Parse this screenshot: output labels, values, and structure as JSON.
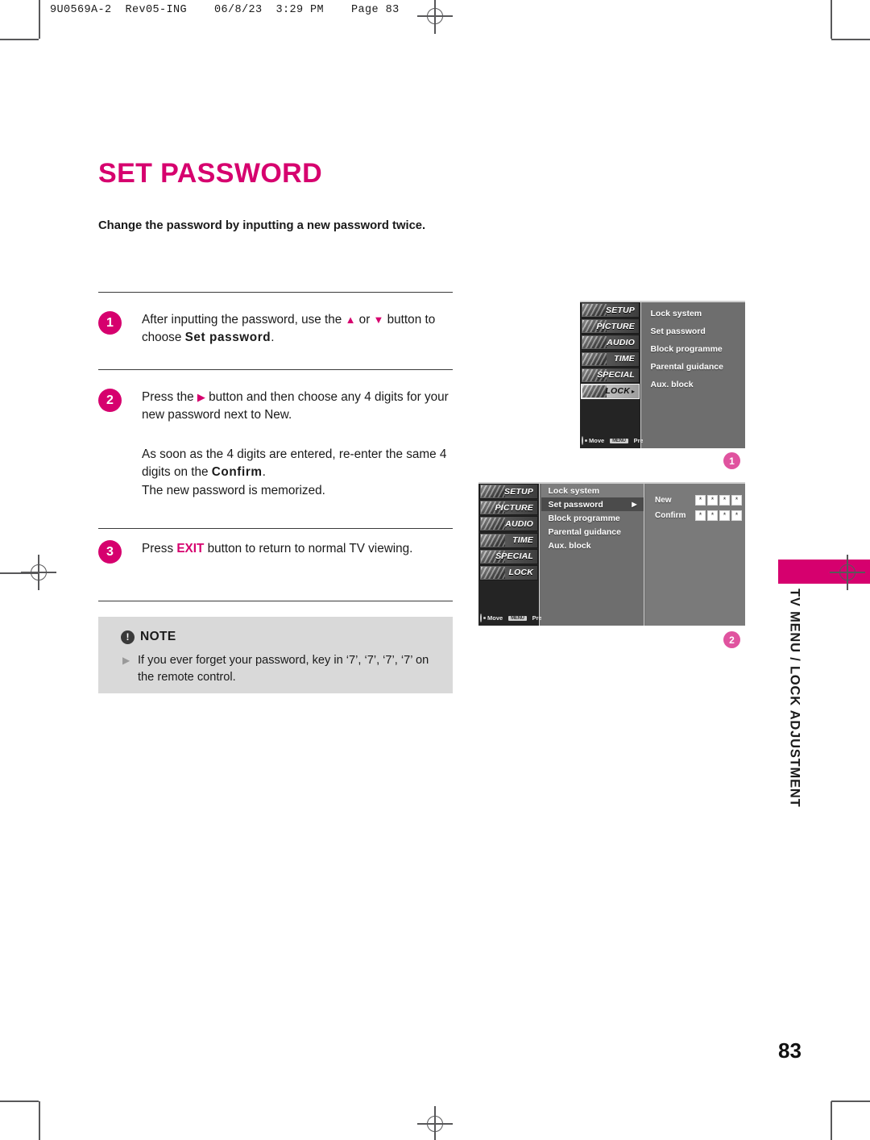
{
  "document": {
    "running_header": "9U0569A-2  Rev05-ING    06/8/23  3:29 PM    Page 83",
    "page_number": "83",
    "side_tab_label": "TV MENU / LOCK ADJUSTMENT",
    "accent_color": "#d6006e",
    "note_bg_color": "#d9d9d9"
  },
  "title": "SET PASSWORD",
  "subtitle": "Change the password by inputting a new password twice.",
  "steps": [
    {
      "number": "1",
      "text_before": "After inputting the password, use the ",
      "tri_up": "▲",
      "text_mid": " or ",
      "tri_down": "▼",
      "text_after": " button to choose ",
      "bold_term": "Set password",
      "text_end": "."
    },
    {
      "number": "2",
      "text_before": "Press the ",
      "tri_right": "▶",
      "text_after": " button and then choose any 4 digits for your new password next to New."
    },
    {
      "number": "",
      "text_before": "As soon as the 4 digits are entered, re-enter the same 4 digits on the ",
      "bold_term": "Confirm",
      "text_after": ".",
      "line2": "The new password is memorized."
    },
    {
      "number": "3",
      "text_before": "Press ",
      "key": "EXIT",
      "text_after": " button to return to normal TV viewing."
    }
  ],
  "note": {
    "icon": "exclamation-icon",
    "bang": "!",
    "title": "NOTE",
    "bullet": "▶",
    "text": "If you ever forget your password, key in ‘7’, ‘7’, ‘7’, ‘7’ on the remote control."
  },
  "osd_screens": [
    {
      "callout": "1",
      "sidebar_items": [
        {
          "label": "SETUP",
          "selected": false
        },
        {
          "label": "PICTURE",
          "selected": false
        },
        {
          "label": "AUDIO",
          "selected": false
        },
        {
          "label": "TIME",
          "selected": false
        },
        {
          "label": "SPECIAL",
          "selected": false
        },
        {
          "label": "LOCK",
          "selected": true,
          "arrow": "▸"
        }
      ],
      "menu_items": [
        "Lock system",
        "Set password",
        "Block programme",
        "Parental guidance",
        "Aux. block"
      ],
      "footer": {
        "move": "Move",
        "menu_key": "MENU",
        "prev": "Prev"
      }
    },
    {
      "callout": "2",
      "sidebar_items": [
        {
          "label": "SETUP",
          "selected": false
        },
        {
          "label": "PICTURE",
          "selected": false
        },
        {
          "label": "AUDIO",
          "selected": false
        },
        {
          "label": "TIME",
          "selected": false
        },
        {
          "label": "SPECIAL",
          "selected": false
        },
        {
          "label": "LOCK",
          "selected": false
        }
      ],
      "menu_items": [
        {
          "label": "Lock system",
          "state": "first"
        },
        {
          "label": "Set password",
          "state": "selected",
          "arrow": "▶"
        },
        {
          "label": "Block programme",
          "state": "normal"
        },
        {
          "label": "Parental guidance",
          "state": "normal"
        },
        {
          "label": "Aux. block",
          "state": "normal"
        }
      ],
      "password_rows": [
        {
          "label": "New",
          "digits": [
            "*",
            "*",
            "*",
            "*"
          ]
        },
        {
          "label": "Confirm",
          "digits": [
            "*",
            "*",
            "*",
            "*"
          ]
        }
      ],
      "footer": {
        "move": "Move",
        "menu_key": "MENU",
        "prev": "Prev"
      }
    }
  ]
}
